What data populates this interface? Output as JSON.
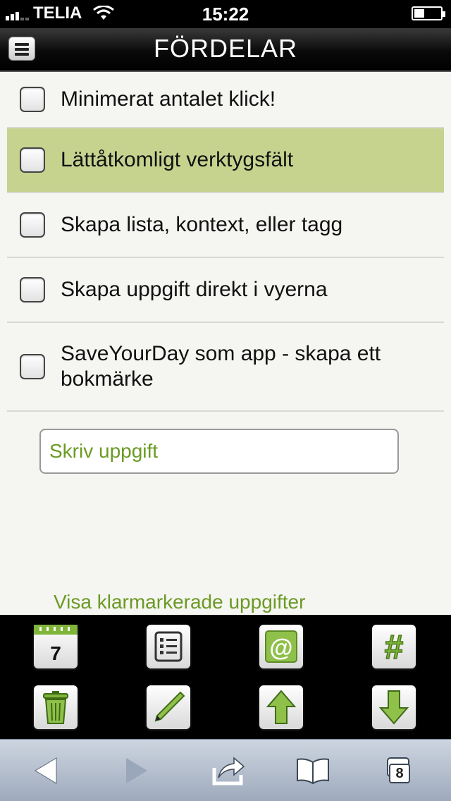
{
  "status": {
    "carrier": "TELIA",
    "time": "15:22"
  },
  "header": {
    "title": "FÖRDELAR"
  },
  "items": [
    {
      "label": "Minimerat antalet klick!",
      "highlighted": false
    },
    {
      "label": "Lättåtkomligt verktygsfält",
      "highlighted": true
    },
    {
      "label": "Skapa lista, kontext, eller tagg",
      "highlighted": false
    },
    {
      "label": "Skapa uppgift direkt i vyerna",
      "highlighted": false
    },
    {
      "label": "SaveYourDay som app - skapa ett bokmärke",
      "highlighted": false
    }
  ],
  "input": {
    "placeholder": "Skriv uppgift"
  },
  "done_link": "Visa klarmarkerade uppgifter",
  "toolbar": {
    "calendar_day": "7",
    "icons": [
      "calendar-icon",
      "list-icon",
      "at-icon",
      "hash-icon",
      "trash-icon",
      "pencil-icon",
      "arrow-up-icon",
      "arrow-down-icon"
    ]
  },
  "browser": {
    "tab_count": "8"
  },
  "colors": {
    "accent_green": "#6b9a24",
    "highlight": "#c5d38f"
  }
}
